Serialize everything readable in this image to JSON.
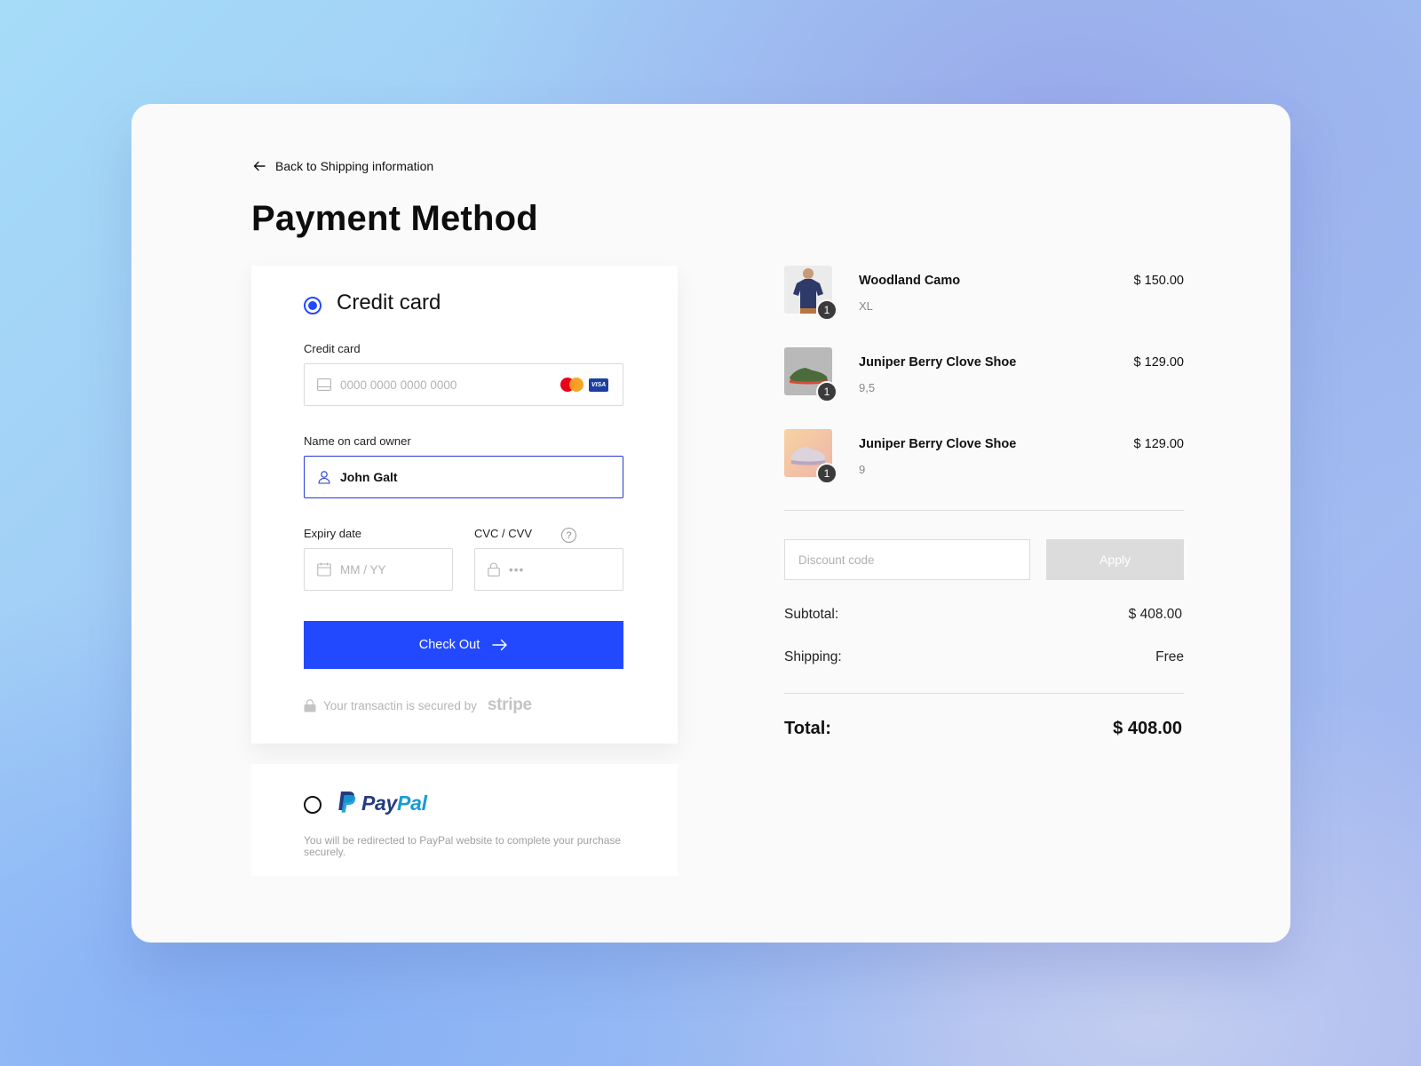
{
  "back_link": {
    "label": "Back to Shipping information"
  },
  "page_title": "Payment Method",
  "credit_card": {
    "option_label": "Credit card",
    "selected": true,
    "card_number": {
      "label": "Credit card",
      "placeholder": "0000 0000 0000 0000",
      "value": ""
    },
    "name_on_card": {
      "label": "Name on card owner",
      "value": "John Galt"
    },
    "expiry": {
      "label": "Expiry date",
      "placeholder": "MM / YY"
    },
    "cvc": {
      "label": "CVC / CVV",
      "placeholder": "•••"
    },
    "card_brands": [
      "mastercard-icon",
      "visa-icon"
    ],
    "visa_text": "VISA",
    "checkout_label": "Check Out",
    "secure_text": "Your transactin is secured by",
    "secure_provider": "stripe"
  },
  "paypal": {
    "option_label_part1": "Pay",
    "option_label_part2": "Pal",
    "selected": false,
    "description": "You will be redirected to PayPal website to complete your purchase securely."
  },
  "order": {
    "items": [
      {
        "name": "Woodland Camo",
        "variant": "XL",
        "price": "$ 150.00",
        "qty": "1",
        "thumb": "tshirt-thumbnail"
      },
      {
        "name": "Juniper Berry Clove Shoe",
        "variant": "9,5",
        "price": "$ 129.00",
        "qty": "1",
        "thumb": "green-shoe-thumbnail"
      },
      {
        "name": "Juniper Berry Clove Shoe",
        "variant": "9",
        "price": "$ 129.00",
        "qty": "1",
        "thumb": "pink-shoe-thumbnail"
      }
    ],
    "discount": {
      "placeholder": "Discount code",
      "apply_label": "Apply"
    },
    "subtotal_label": "Subtotal:",
    "subtotal_value": "$ 408.00",
    "shipping_label": "Shipping:",
    "shipping_value": "Free",
    "total_label": "Total:",
    "total_value": "$ 408.00"
  },
  "colors": {
    "accent": "#2349ff",
    "paypal_dark": "#253b80",
    "paypal_light": "#179bd7",
    "mastercard_red": "#eb001b",
    "mastercard_orange": "#f79e1b"
  }
}
